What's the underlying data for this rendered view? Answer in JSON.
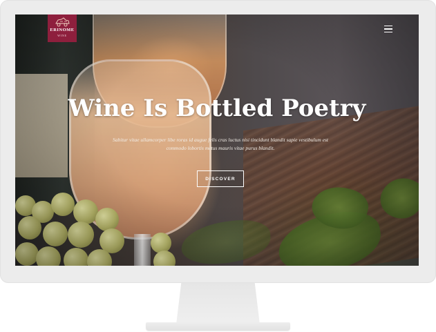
{
  "site": {
    "logo": {
      "name": "ERINOME",
      "subtitle": "WINE",
      "brand_color": "#8e1f3d"
    },
    "nav": {
      "menu_icon": "hamburger-menu-icon"
    },
    "hero": {
      "title": "Wine Is Bottled Poetry",
      "subtitle": "Sabitur vitae ullamcorper libe roras id augue felis cras luctus nisi tincidunt blandit sapie vestibulum est commodo lobortis metus mauris vitae purus blandit.",
      "cta_label": "DISCOVER"
    }
  }
}
